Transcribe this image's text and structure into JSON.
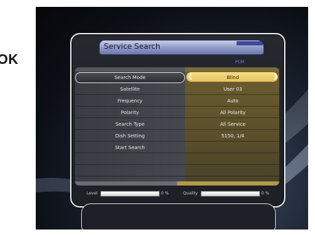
{
  "side_label": "OK",
  "window": {
    "title": "Service Search",
    "status_tag": "PCM"
  },
  "menu": {
    "rows": [
      {
        "label": "Search Mode",
        "value": "Blind",
        "selected": true
      },
      {
        "label": "Satellite",
        "value": "User 03"
      },
      {
        "label": "Frequency",
        "value": "Auto"
      },
      {
        "label": "Polarity",
        "value": "All Polarity"
      },
      {
        "label": "Search Type",
        "value": "All Service"
      },
      {
        "label": "Dish Setting",
        "value": "5150, 1/4"
      },
      {
        "label": "Start Search",
        "value": ""
      }
    ]
  },
  "meters": {
    "level_label": "Level",
    "level_value": "0 %",
    "quality_label": "Quality",
    "quality_value": "0 %"
  },
  "colors": {
    "title_tab": "#8e98c4",
    "value_column": "#5a4f2b",
    "highlight": "#e6c25a",
    "status_tag": "#6f86d6"
  }
}
